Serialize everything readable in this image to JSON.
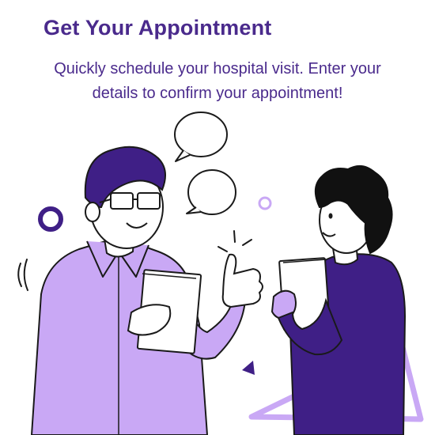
{
  "header": {
    "title": "Get Your Appointment",
    "subtitle_line1": "Quickly schedule your hospital visit. Enter your",
    "subtitle_line2": "details to confirm your appointment!"
  },
  "colors": {
    "heading": "#4a2a8c",
    "light_purple": "#c9a8f5",
    "dark_purple": "#3f1f86",
    "outline": "#1a1a1a"
  },
  "illustration": {
    "subjects": [
      "man-with-notebook-thumbs-up",
      "woman-with-notebook"
    ],
    "icons": [
      "speech-bubble-icon",
      "ring-icon",
      "triangle-icon"
    ]
  }
}
